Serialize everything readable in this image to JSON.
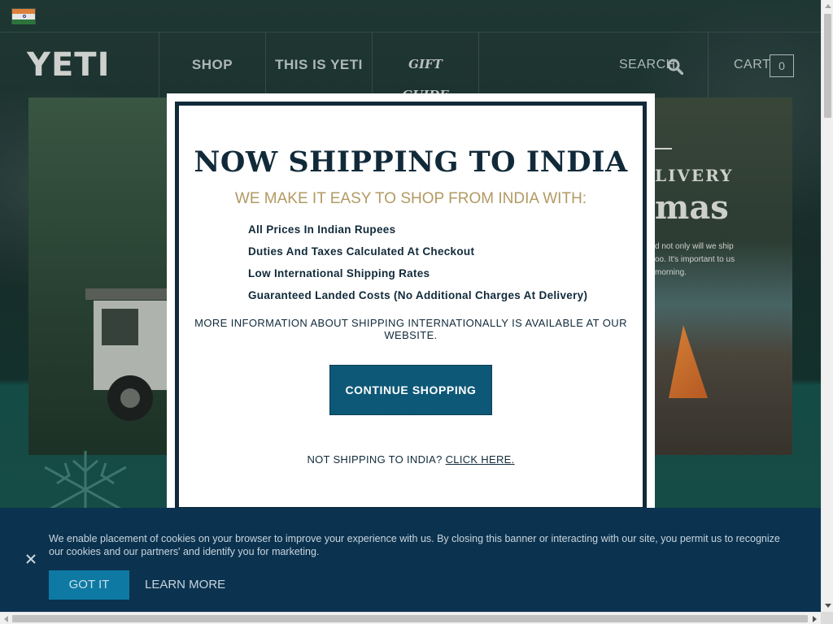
{
  "header": {
    "logo": "YETI",
    "nav": [
      {
        "label": "SHOP"
      },
      {
        "label": "THIS IS YETI"
      },
      {
        "label": "GIFT GUIDE"
      }
    ],
    "search_label": "SEARCH",
    "cart_label": "CART",
    "cart_count": "0",
    "country_flag": "india-flag-icon"
  },
  "hero": {
    "heading_partial_1": "LIVERY",
    "heading_partial_2": "mas",
    "body_partial": "d not only will we ship oo. It's important to us morning."
  },
  "modal": {
    "title": "NOW SHIPPING TO INDIA",
    "subtitle": "WE MAKE IT EASY TO SHOP FROM INDIA WITH:",
    "benefits": [
      "All Prices In Indian Rupees",
      "Duties And Taxes Calculated At Checkout",
      "Low International Shipping Rates",
      "Guaranteed Landed Costs (No Additional Charges At Delivery)"
    ],
    "more_info": "MORE INFORMATION ABOUT SHIPPING INTERNATIONALLY IS AVAILABLE AT OUR WEBSITE.",
    "continue_button": "CONTINUE SHOPPING",
    "not_shipping_prefix": "NOT SHIPPING TO INDIA?",
    "not_shipping_link": "CLICK HERE."
  },
  "cookie_banner": {
    "text": "We enable placement of cookies on your browser to improve your experience with us. By closing this banner or interacting with our site, you permit us to recognize our cookies and our partners' and identify you for marketing.",
    "accept_button": "GOT IT",
    "learn_more": "LEARN MORE"
  },
  "colors": {
    "modal_navy": "#112a3a",
    "subtitle_gold": "#b29a63",
    "continue_button": "#0e5877",
    "cookie_banner_bg": "#0b3350",
    "got_it_button": "#0e7aa3"
  }
}
